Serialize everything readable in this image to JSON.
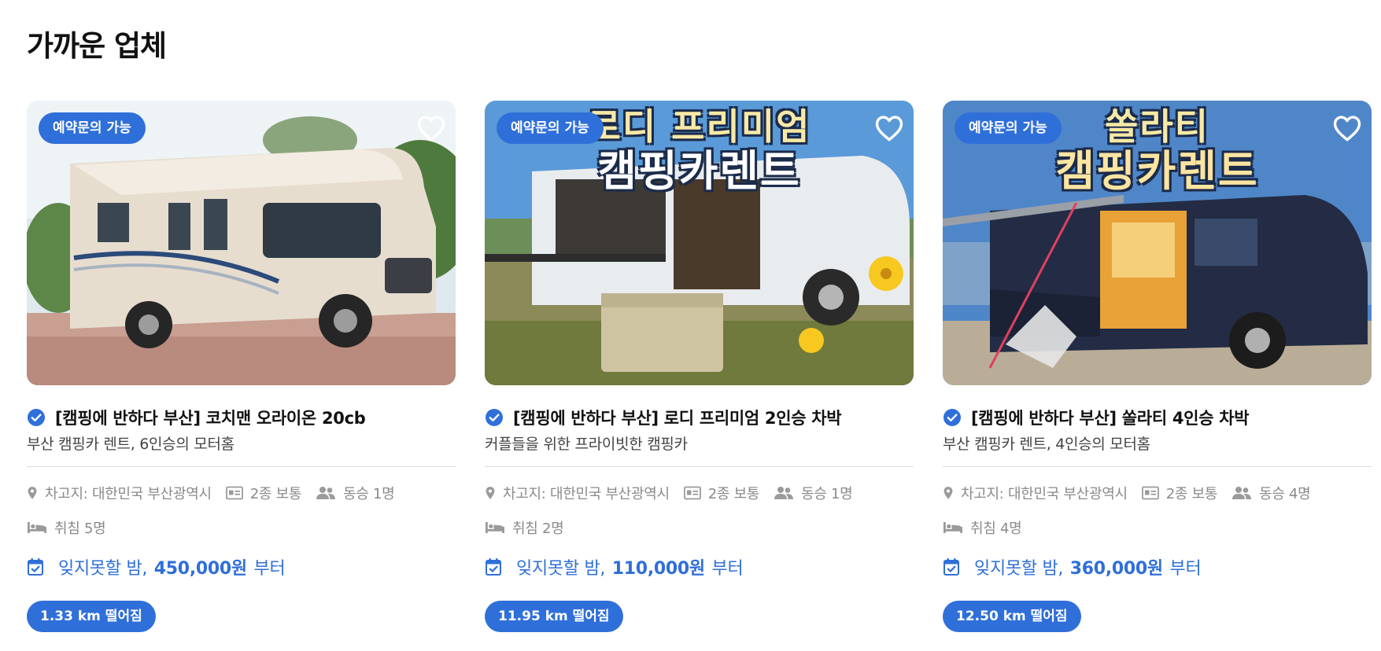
{
  "section_title": "가까운 업체",
  "colors": {
    "accent": "#2f6fd9",
    "divider": "#dcdcdc",
    "meta_text": "#8a8a8a"
  },
  "icons": {
    "verified": "check-circle-icon",
    "favorite": "heart-outline-icon",
    "location": "location-pin-icon",
    "license": "id-card-icon",
    "passengers": "users-icon",
    "sleeping": "bed-icon",
    "calendar": "calendar-check-icon"
  },
  "cards": [
    {
      "badge": "예약문의 가능",
      "title": "[캠핑에 반하다 부산] 코치맨 오라이온 20cb",
      "subtitle": "부산 캠핑카 렌트, 6인승의 모터홈",
      "location": "차고지: 대한민국 부산광역시",
      "license": "2종 보통",
      "passengers": "동승 1명",
      "sleeping": "취침 5명",
      "price_prefix": "잊지못할 밤,",
      "price": "450,000원",
      "price_suffix": "부터",
      "distance": "1.33 km 떨어짐"
    },
    {
      "badge": "예약문의 가능",
      "image_text_1": "로디 프리미엄",
      "image_text_2": "캠핑카렌트",
      "title": "[캠핑에 반하다 부산] 로디 프리미엄 2인승 차박",
      "subtitle": "커플들을 위한 프라이빗한 캠핑카",
      "location": "차고지: 대한민국 부산광역시",
      "license": "2종 보통",
      "passengers": "동승 1명",
      "sleeping": "취침 2명",
      "price_prefix": "잊지못할 밤,",
      "price": "110,000원",
      "price_suffix": "부터",
      "distance": "11.95 km 떨어짐"
    },
    {
      "badge": "예약문의 가능",
      "image_text_1": "쏠라티",
      "image_text_2": "캠핑카렌트",
      "title": "[캠핑에 반하다 부산] 쏠라티 4인승 차박",
      "subtitle": "부산 캠핑카 렌트, 4인승의 모터홈",
      "location": "차고지: 대한민국 부산광역시",
      "license": "2종 보통",
      "passengers": "동승 4명",
      "sleeping": "취침 4명",
      "price_prefix": "잊지못할 밤,",
      "price": "360,000원",
      "price_suffix": "부터",
      "distance": "12.50 km 떨어짐"
    }
  ]
}
